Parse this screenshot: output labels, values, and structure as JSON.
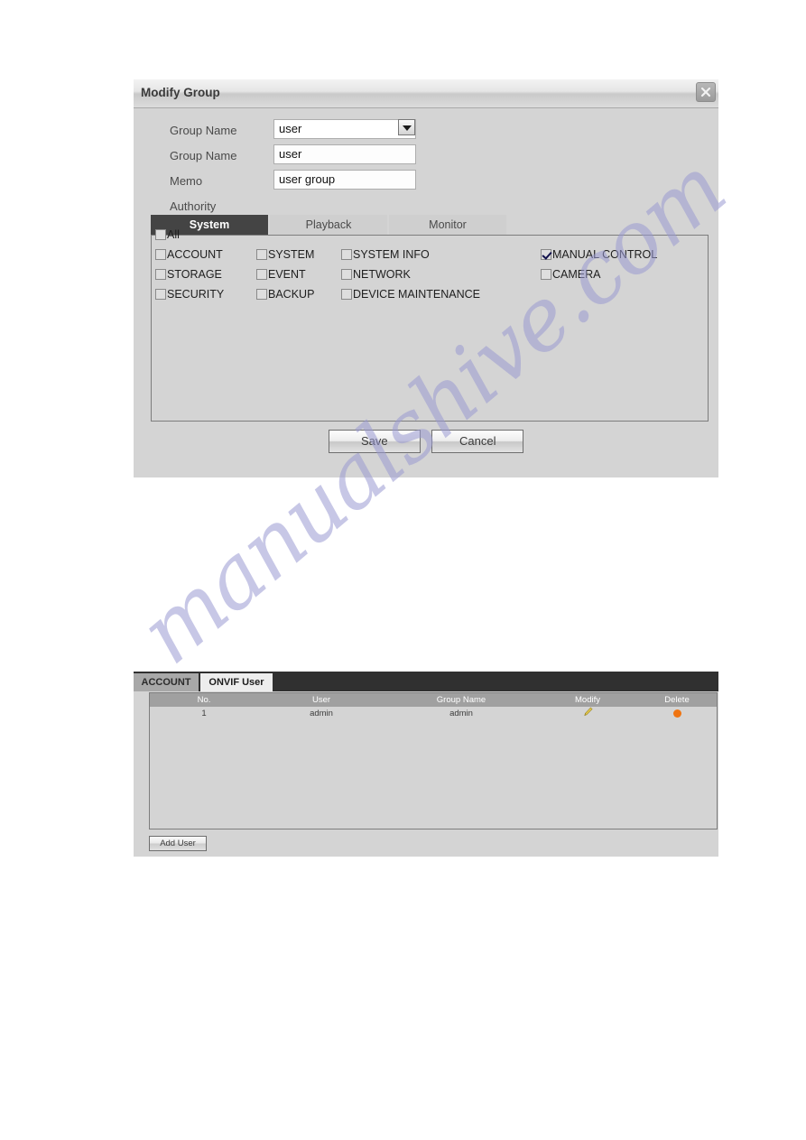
{
  "watermark": {
    "text": "manualshive.com"
  },
  "dialog": {
    "title": "Modify Group",
    "close_icon": "close-icon",
    "fields": [
      {
        "label": "Group Name",
        "value": "user",
        "type": "select"
      },
      {
        "label": "Group Name",
        "value": "user",
        "type": "text"
      },
      {
        "label": "Memo",
        "value": "user group",
        "type": "text"
      },
      {
        "label": "Authority",
        "value": "",
        "type": "none"
      }
    ],
    "tabs": [
      {
        "label": "System",
        "active": true
      },
      {
        "label": "Playback",
        "active": false
      },
      {
        "label": "Monitor",
        "active": false
      }
    ],
    "permissions": {
      "all": {
        "label": "All",
        "checked": false
      },
      "rows": [
        [
          {
            "label": "ACCOUNT",
            "checked": false
          },
          {
            "label": "SYSTEM",
            "checked": false
          },
          {
            "label": "SYSTEM INFO",
            "checked": false
          },
          {
            "label": "MANUAL CONTROL",
            "checked": true
          }
        ],
        [
          {
            "label": "STORAGE",
            "checked": false
          },
          {
            "label": "EVENT",
            "checked": false
          },
          {
            "label": "NETWORK",
            "checked": false
          },
          {
            "label": "CAMERA",
            "checked": false
          }
        ],
        [
          {
            "label": "SECURITY",
            "checked": false
          },
          {
            "label": "BACKUP",
            "checked": false
          },
          {
            "label": "DEVICE MAINTENANCE",
            "checked": false
          }
        ]
      ]
    },
    "buttons": {
      "save": "Save",
      "cancel": "Cancel"
    }
  },
  "onvif_panel": {
    "tabs": [
      {
        "label": "ACCOUNT",
        "active": false
      },
      {
        "label": "ONVIF User",
        "active": true
      }
    ],
    "table": {
      "headers": [
        "No.",
        "User",
        "Group Name",
        "Modify",
        "Delete"
      ],
      "rows": [
        {
          "no": "1",
          "user": "admin",
          "group_name": "admin",
          "modify_icon": "pencil-icon",
          "delete_icon": "delete-dot-icon"
        }
      ]
    },
    "add_user_button": "Add User"
  },
  "colors": {
    "dialog_bg": "#d4d4d4",
    "tab_active_bg": "#444444",
    "onvif_tabbar_bg": "#303030",
    "table_header_bg": "#a0a0a0",
    "check_mark": "#13134d",
    "delete_dot": "#ef7411",
    "pencil": "#e3c64a",
    "watermark": "#9a9ad2"
  }
}
